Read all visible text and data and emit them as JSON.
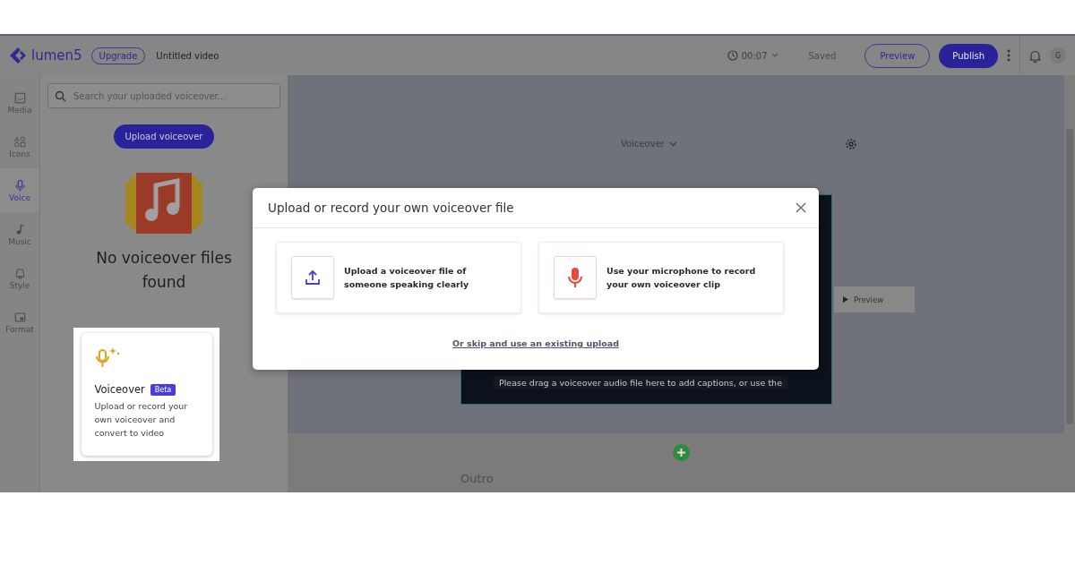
{
  "header": {
    "logo": "lumen5",
    "upgrade": "Upgrade",
    "title": "Untitled video",
    "duration": "00:07",
    "status": "Saved",
    "preview": "Preview",
    "publish": "Publish",
    "avatar": "G"
  },
  "nav": [
    {
      "label": "Media",
      "selected": false
    },
    {
      "label": "Icons",
      "selected": false
    },
    {
      "label": "Voice",
      "selected": true
    },
    {
      "label": "Music",
      "selected": false
    },
    {
      "label": "Style",
      "selected": false
    },
    {
      "label": "Format",
      "selected": false
    }
  ],
  "panel": {
    "search": {
      "placeholder": "Search your uploaded voiceover..."
    },
    "upload_button": "Upload voiceover",
    "empty_message": "No voiceover files found"
  },
  "promo_card": {
    "title": "Voiceover",
    "badge": "Beta",
    "text": "Upload or record your own voiceover and convert to video"
  },
  "canvas": {
    "dropdown": "Voiceover",
    "caption": "Please drag a voiceover audio file here to add captions, or use the",
    "preview": "Preview",
    "section": "Outro"
  },
  "modal": {
    "title": "Upload or record your own voiceover file",
    "options": [
      {
        "kind": "upload",
        "text": "Upload a voiceover file of someone speaking clearly"
      },
      {
        "kind": "record",
        "text": "Use your microphone to record your own voiceover clip"
      }
    ],
    "link": "Or skip and use an existing upload"
  }
}
